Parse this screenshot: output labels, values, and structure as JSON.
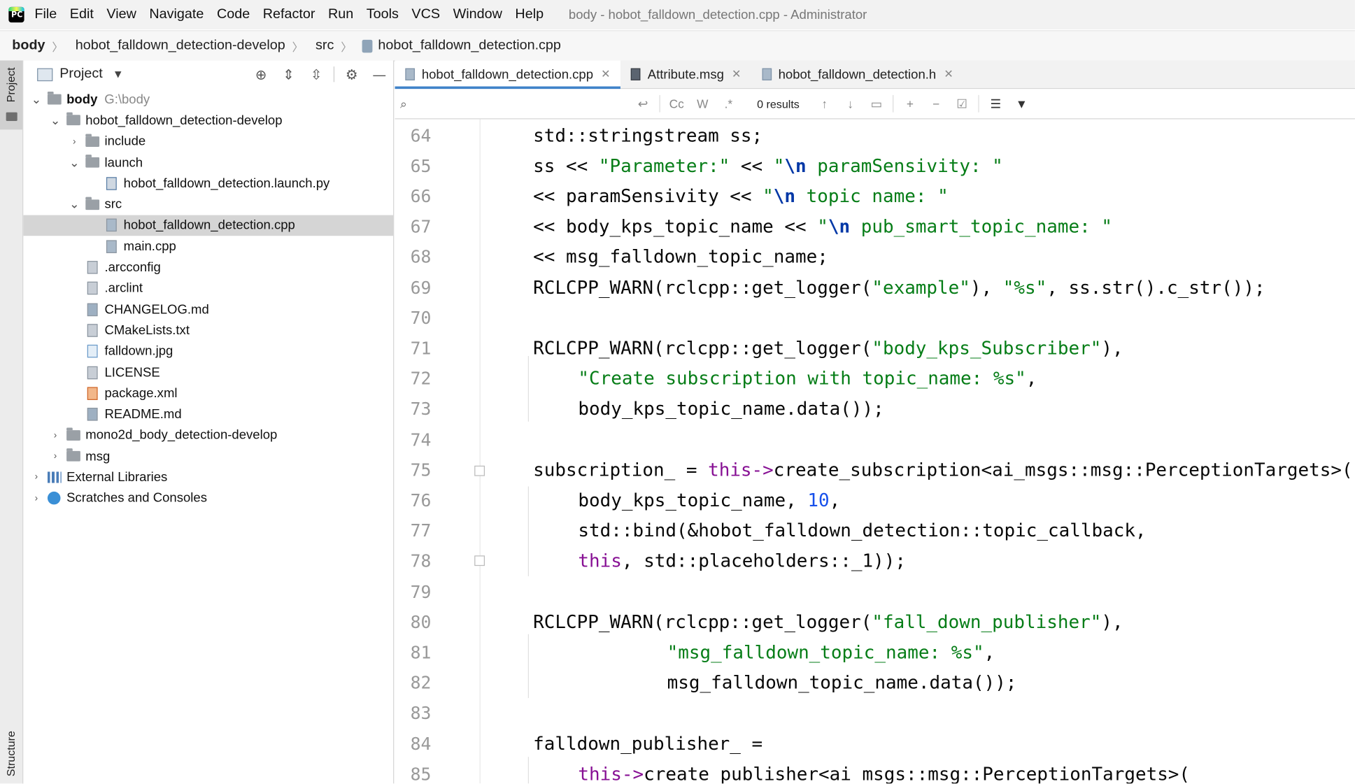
{
  "menubar": {
    "items": [
      "File",
      "Edit",
      "View",
      "Navigate",
      "Code",
      "Refactor",
      "Run",
      "Tools",
      "VCS",
      "Window",
      "Help"
    ],
    "window_title": "body - hobot_falldown_detection.cpp - Administrator"
  },
  "breadcrumb": [
    "body",
    "hobot_falldown_detection-develop",
    "src",
    "hobot_falldown_detection.cpp"
  ],
  "left_strip": {
    "project_label": "Project",
    "structure_label": "Structure"
  },
  "project_panel": {
    "title": "Project",
    "tree": [
      {
        "label": "body",
        "path": "G:\\body",
        "depth": 0,
        "expanded": true,
        "icon": "folder-icon"
      },
      {
        "label": "hobot_falldown_detection-develop",
        "depth": 1,
        "expanded": true,
        "icon": "folder-icon"
      },
      {
        "label": "include",
        "depth": 2,
        "expanded": false,
        "icon": "folder-icon"
      },
      {
        "label": "launch",
        "depth": 2,
        "expanded": true,
        "icon": "folder-icon"
      },
      {
        "label": "hobot_falldown_detection.launch.py",
        "depth": 3,
        "icon": "python-file-icon"
      },
      {
        "label": "src",
        "depth": 2,
        "expanded": true,
        "icon": "folder-icon"
      },
      {
        "label": "hobot_falldown_detection.cpp",
        "depth": 3,
        "icon": "cpp-file-icon",
        "selected": true
      },
      {
        "label": "main.cpp",
        "depth": 3,
        "icon": "cpp-file-icon"
      },
      {
        "label": ".arcconfig",
        "depth": 2,
        "icon": "text-file-icon"
      },
      {
        "label": ".arclint",
        "depth": 2,
        "icon": "text-file-icon"
      },
      {
        "label": "CHANGELOG.md",
        "depth": 2,
        "icon": "markdown-file-icon"
      },
      {
        "label": "CMakeLists.txt",
        "depth": 2,
        "icon": "text-file-icon"
      },
      {
        "label": "falldown.jpg",
        "depth": 2,
        "icon": "image-file-icon"
      },
      {
        "label": "LICENSE",
        "depth": 2,
        "icon": "text-file-icon"
      },
      {
        "label": "package.xml",
        "depth": 2,
        "icon": "xml-file-icon"
      },
      {
        "label": "README.md",
        "depth": 2,
        "icon": "markdown-file-icon"
      },
      {
        "label": "mono2d_body_detection-develop",
        "depth": 1,
        "expanded": false,
        "icon": "folder-icon"
      },
      {
        "label": "msg",
        "depth": 1,
        "expanded": false,
        "icon": "folder-icon"
      },
      {
        "label": "External Libraries",
        "depth": 0,
        "expanded": false,
        "icon": "library-icon"
      },
      {
        "label": "Scratches and Consoles",
        "depth": 0,
        "expanded": false,
        "icon": "scratches-icon"
      }
    ]
  },
  "tabs": [
    {
      "label": "hobot_falldown_detection.cpp",
      "active": true,
      "icon": "cpp-file-icon"
    },
    {
      "label": "Attribute.msg",
      "active": false,
      "icon": "msg-file-icon"
    },
    {
      "label": "hobot_falldown_detection.h",
      "active": false,
      "icon": "header-file-icon"
    }
  ],
  "search": {
    "value": "",
    "placeholder": "",
    "results": "0 results",
    "case_label": "Cc",
    "word_label": "W",
    "regex_label": ".*"
  },
  "editor": {
    "lines": [
      {
        "n": "64",
        "indent": 0,
        "tokens": [
          [
            "std::stringstream ss;",
            ""
          ]
        ]
      },
      {
        "n": "65",
        "indent": 0,
        "tokens": [
          [
            "ss << ",
            ""
          ],
          [
            "\"Parameter:\"",
            "str"
          ],
          [
            " << ",
            ""
          ],
          [
            "\"",
            "str"
          ],
          [
            "\\n",
            "esc"
          ],
          [
            " paramSensivity: \"",
            "str"
          ]
        ]
      },
      {
        "n": "66",
        "indent": 0,
        "tokens": [
          [
            "<< paramSensivity << ",
            ""
          ],
          [
            "\"",
            "str"
          ],
          [
            "\\n",
            "esc"
          ],
          [
            " topic name: \"",
            "str"
          ]
        ]
      },
      {
        "n": "67",
        "indent": 0,
        "tokens": [
          [
            "<< body_kps_topic_name << ",
            ""
          ],
          [
            "\"",
            "str"
          ],
          [
            "\\n",
            "esc"
          ],
          [
            " pub_smart_topic_name: \"",
            "str"
          ]
        ]
      },
      {
        "n": "68",
        "indent": 0,
        "tokens": [
          [
            "<< msg_falldown_topic_name;",
            ""
          ]
        ]
      },
      {
        "n": "69",
        "indent": 0,
        "tokens": [
          [
            "RCLCPP_WARN(rclcpp::get_logger(",
            ""
          ],
          [
            "\"example\"",
            "str"
          ],
          [
            "), ",
            ""
          ],
          [
            "\"%s\"",
            "str"
          ],
          [
            ", ss.str().c_str());",
            ""
          ]
        ]
      },
      {
        "n": "70",
        "indent": 0,
        "tokens": []
      },
      {
        "n": "71",
        "indent": 0,
        "tokens": [
          [
            "RCLCPP_WARN(rclcpp::get_logger(",
            ""
          ],
          [
            "\"body_kps_Subscriber\"",
            "str"
          ],
          [
            "),",
            ""
          ]
        ]
      },
      {
        "n": "72",
        "indent": 1,
        "tokens": [
          [
            "\"Create subscription with topic_name: %s\"",
            "str"
          ],
          [
            ",",
            ""
          ]
        ]
      },
      {
        "n": "73",
        "indent": 1,
        "tokens": [
          [
            "body_kps_topic_name.data());",
            ""
          ]
        ]
      },
      {
        "n": "74",
        "indent": 0,
        "tokens": []
      },
      {
        "n": "75",
        "indent": 0,
        "tokens": [
          [
            "subscription_ = ",
            ""
          ],
          [
            "this",
            "kw"
          ],
          [
            "->",
            "kw"
          ],
          [
            "create_subscription<ai_msgs::msg::PerceptionTargets>(",
            ""
          ]
        ]
      },
      {
        "n": "76",
        "indent": 1,
        "tokens": [
          [
            "body_kps_topic_name, ",
            ""
          ],
          [
            "10",
            "num"
          ],
          [
            ",",
            ""
          ]
        ]
      },
      {
        "n": "77",
        "indent": 1,
        "tokens": [
          [
            "std::bind(&hobot_falldown_detection::topic_callback,",
            ""
          ]
        ]
      },
      {
        "n": "78",
        "indent": 1,
        "tokens": [
          [
            "this",
            "kw"
          ],
          [
            ", std::placeholders::_1));",
            ""
          ]
        ]
      },
      {
        "n": "79",
        "indent": 0,
        "tokens": []
      },
      {
        "n": "80",
        "indent": 0,
        "tokens": [
          [
            "RCLCPP_WARN(rclcpp::get_logger(",
            ""
          ],
          [
            "\"fall_down_publisher\"",
            "str"
          ],
          [
            "),",
            ""
          ]
        ]
      },
      {
        "n": "81",
        "indent": 2,
        "tokens": [
          [
            "\"msg_falldown_topic_name: %s\"",
            "str"
          ],
          [
            ",",
            ""
          ]
        ]
      },
      {
        "n": "82",
        "indent": 2,
        "tokens": [
          [
            "msg_falldown_topic_name.data());",
            ""
          ]
        ]
      },
      {
        "n": "83",
        "indent": 0,
        "tokens": []
      },
      {
        "n": "84",
        "indent": 0,
        "tokens": [
          [
            "falldown_publisher_ =",
            ""
          ]
        ]
      },
      {
        "n": "85",
        "indent": 1,
        "tokens": [
          [
            "this",
            "kw"
          ],
          [
            "->",
            "kw"
          ],
          [
            "create_publisher<ai_msgs::msg::PerceptionTargets>(",
            ""
          ]
        ]
      }
    ]
  },
  "colors": {
    "keyword": "#871094",
    "string": "#067d17",
    "escape": "#0037a6",
    "number": "#1750eb",
    "accent": "#4083c9",
    "selection": "#d5d5d5"
  }
}
